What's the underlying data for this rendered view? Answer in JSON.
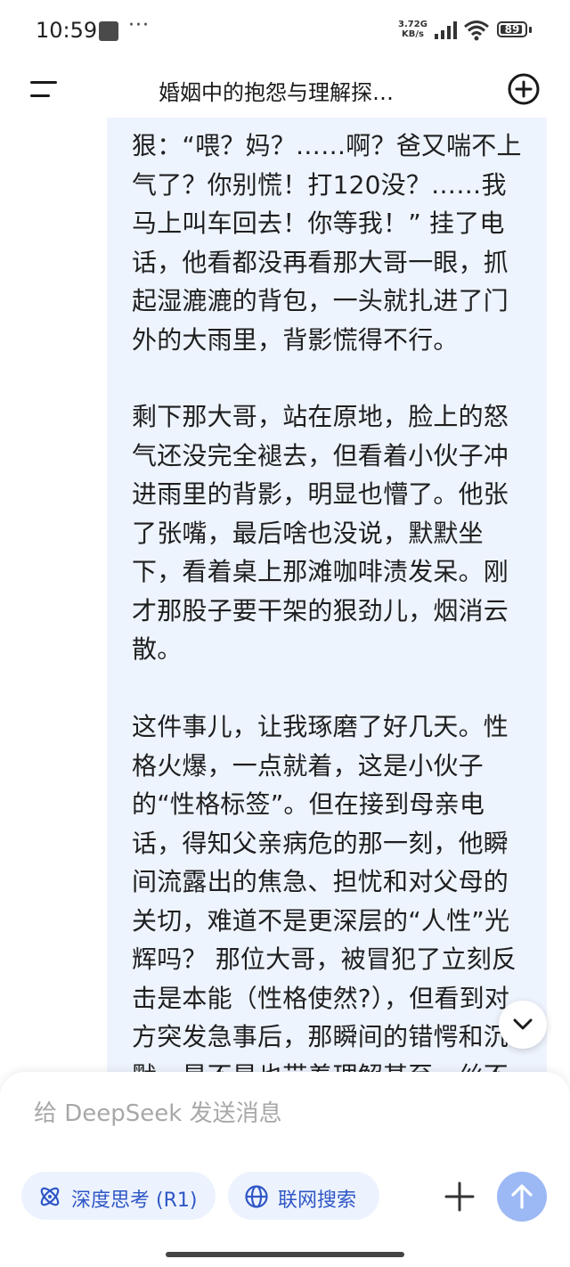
{
  "status_bar": {
    "time": "10:59",
    "more": "···",
    "net_speed_value": "3.72",
    "net_speed_unit_top": "G",
    "net_speed_unit": "KB/s",
    "battery": "89"
  },
  "header": {
    "title": "婚姻中的抱怨与理解探…"
  },
  "message": {
    "paragraphs": [
      "狠：“喂？妈？……啊？爸又喘不上气了？你别慌！打120没？……我马上叫车回去！你等我！” 挂了电话，他看都没再看那大哥一眼，抓起湿漉漉的背包，一头就扎进了门外的大雨里，背影慌得不行。",
      "剩下那大哥，站在原地，脸上的怒气还没完全褪去，但看着小伙子冲进雨里的背影，明显也懵了。他张了张嘴，最后啥也没说，默默坐下，看着桌上那滩咖啡渍发呆。刚才那股子要干架的狠劲儿，烟消云散。",
      "这件事儿，让我琢磨了好几天。性格火爆，一点就着，这是小伙子的“性格标签”。但在接到母亲电话，得知父亲病危的那一刻，他瞬间流露出的焦急、担忧和对父母的关切，难道不是更深层的“人性”光辉吗？ 那位大哥，被冒犯了立刻反击是本能（性格使然?），但看到对方突发急事后，那瞬间的错愕和沉默，是不是也带着理解甚至一丝不"
    ]
  },
  "composer": {
    "placeholder": "给 DeepSeek 发送消息",
    "deep_think_label": "深度思考 (R1)",
    "web_search_label": "联网搜索"
  },
  "colors": {
    "card_bg": "#eef4fe",
    "chip_bg": "#edf3fe",
    "chip_text": "#2f57c6",
    "send_bg": "#9cb9f5"
  }
}
